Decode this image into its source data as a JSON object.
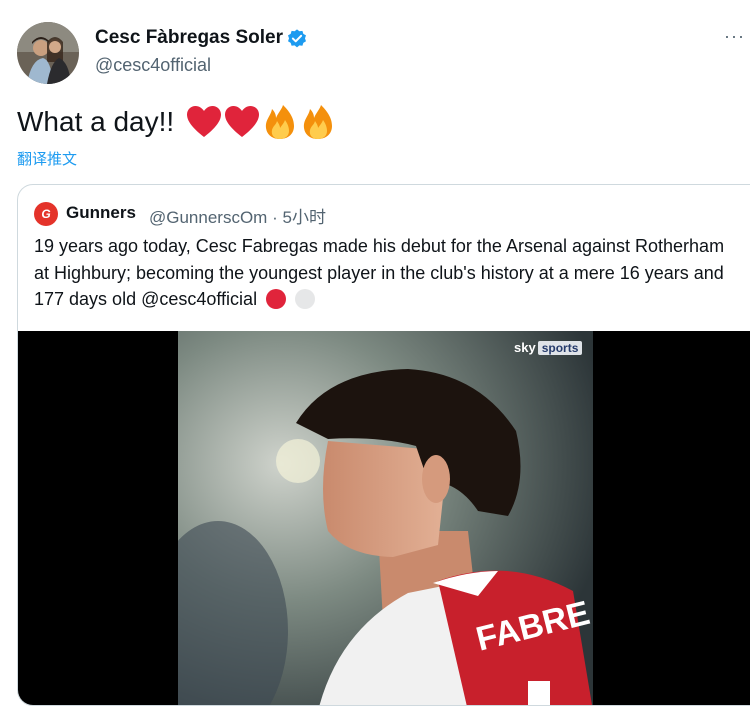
{
  "author": {
    "display_name": "Cesc Fàbregas Soler",
    "handle": "@cesc4official",
    "verified_icon": "verified-badge-icon",
    "avatar_icon": "avatar"
  },
  "more_label": "···",
  "tweet": {
    "text": "What a day!!",
    "emojis": [
      "red-heart",
      "red-heart",
      "fire",
      "fire"
    ],
    "translate_label": "翻译推文"
  },
  "quote": {
    "logo_text": "G",
    "name": "Gunners",
    "handle": "@GunnerscOm",
    "separator": "·",
    "time": "5小时",
    "text": "19 years ago today, Cesc Fabregas made his debut for the Arsenal against Rotherham at Highbury; becoming the youngest player in the club's history at a mere 16 years and 177 days old @cesc4official",
    "media": {
      "brand_left": "sky",
      "brand_right": "sports",
      "shirt_text": "FABRE"
    }
  },
  "colors": {
    "accent": "#1d9bf0",
    "secondary_text": "#536471",
    "arsenal_red": "#e4332a",
    "heart_red": "#e0243b"
  }
}
